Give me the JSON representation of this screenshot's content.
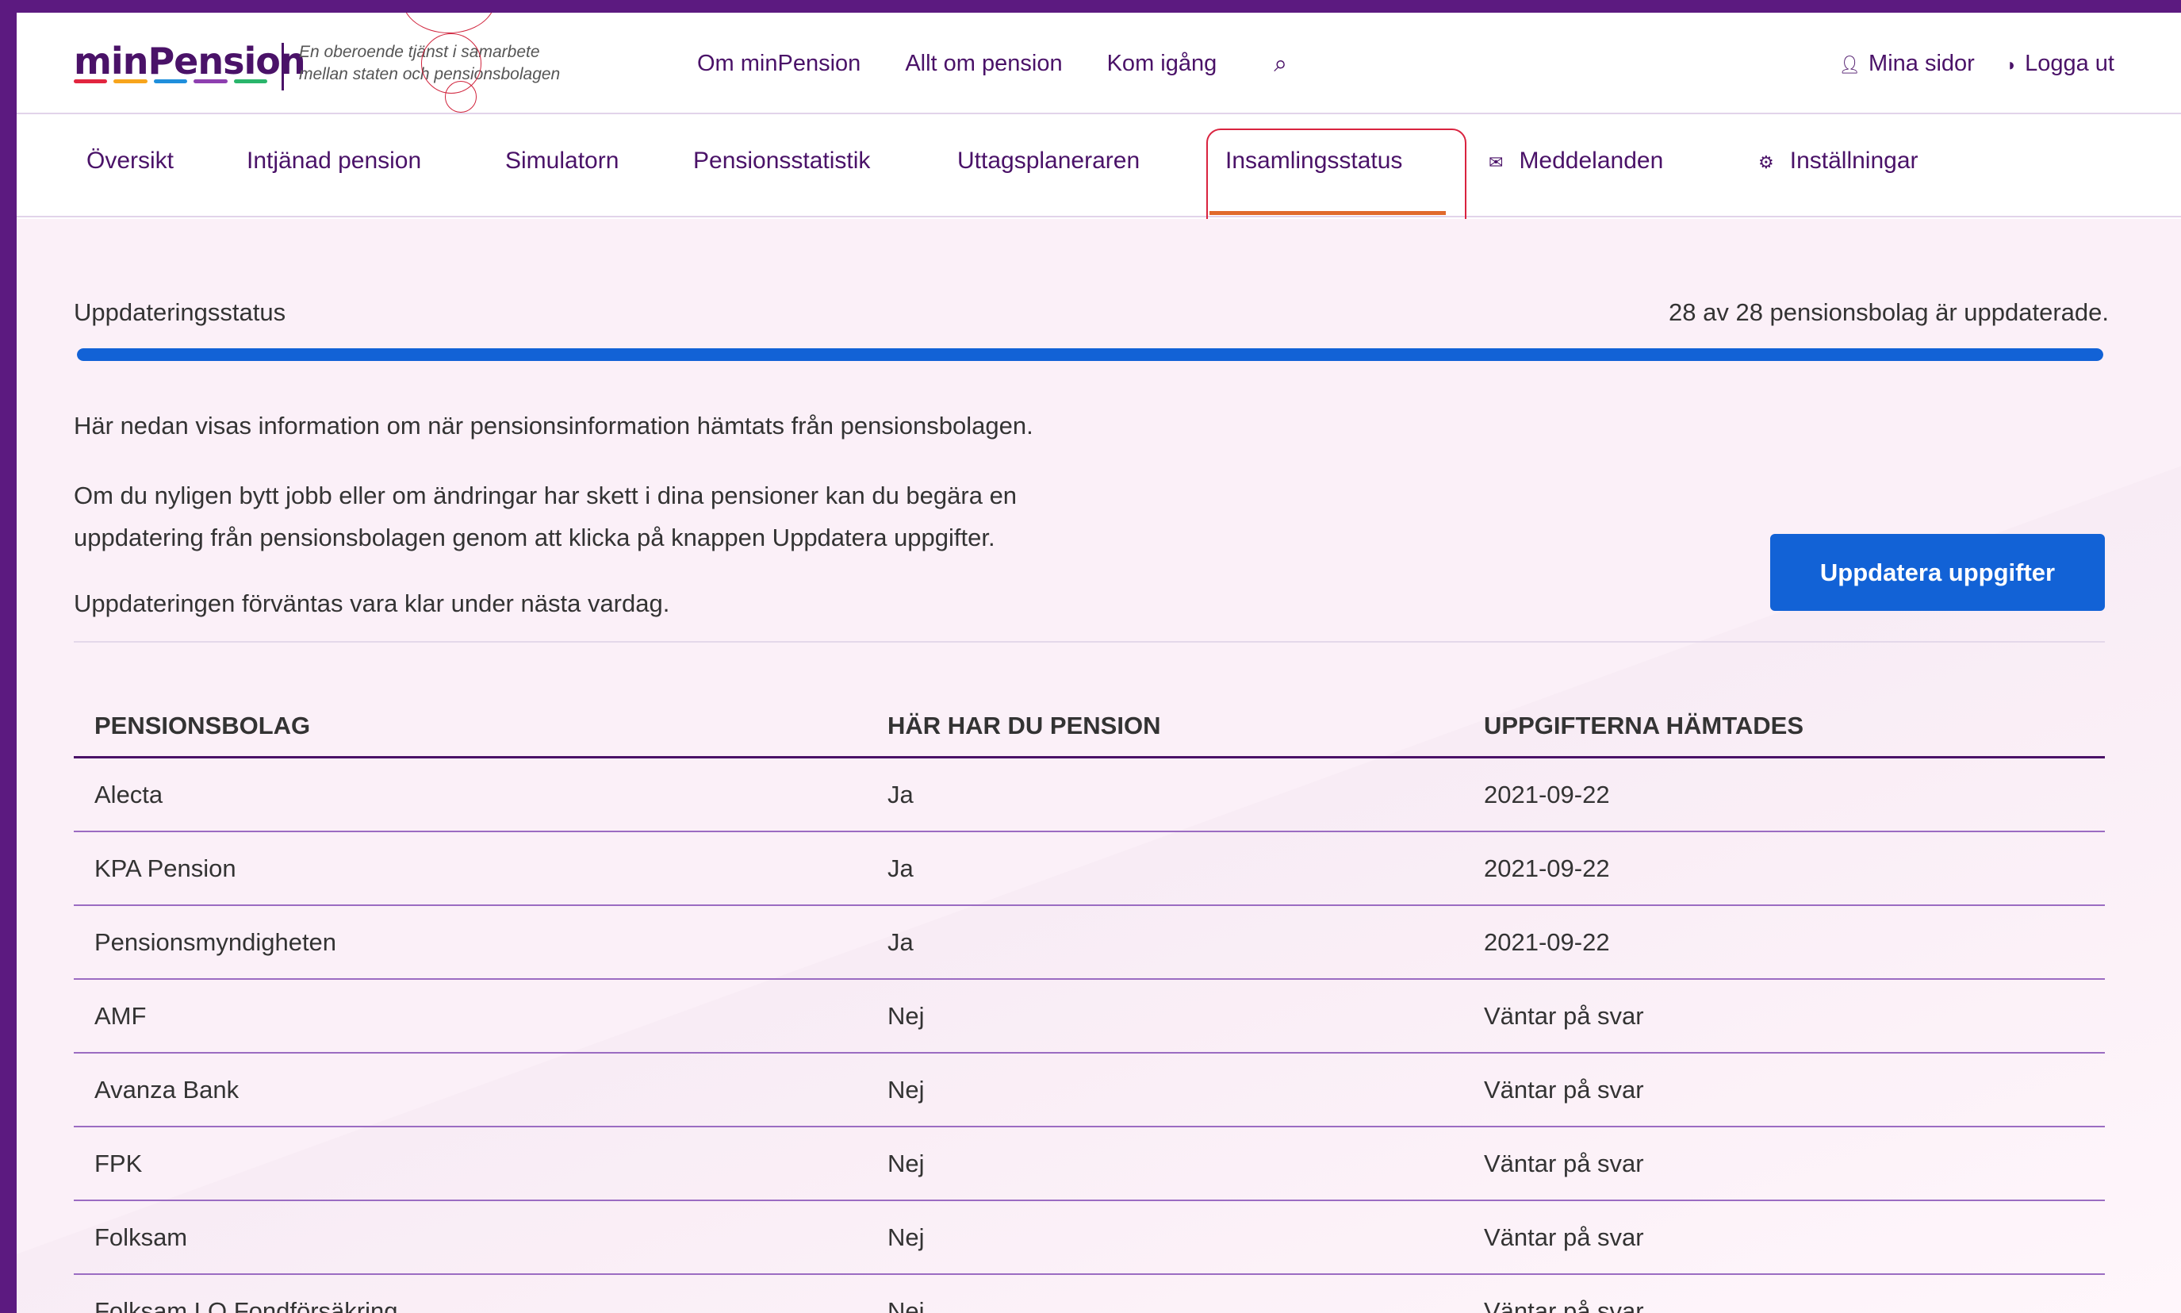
{
  "brand": {
    "logo_text": "minPension",
    "tagline_line1": "En oberoende tjänst i samarbete",
    "tagline_line2": "mellan staten och pensionsbolagen",
    "stripe_colors": [
      "#e2253f",
      "#f7a51c",
      "#1f8fdc",
      "#8e3fb0",
      "#2ab56b"
    ]
  },
  "topnav": {
    "items": [
      "Om minPension",
      "Allt om pension",
      "Kom igång"
    ],
    "search_icon": "search-icon"
  },
  "user": {
    "my_pages": "Mina sidor",
    "logout": "Logga ut"
  },
  "subnav": {
    "items": [
      {
        "label": "Översikt"
      },
      {
        "label": "Intjänad pension"
      },
      {
        "label": "Simulatorn"
      },
      {
        "label": "Pensionsstatistik"
      },
      {
        "label": "Uttagsplaneraren"
      },
      {
        "label": "Insamlingsstatus",
        "active": true
      },
      {
        "label": "Meddelanden",
        "icon": "envelope-icon"
      },
      {
        "label": "Inställningar",
        "icon": "gear-icon"
      }
    ]
  },
  "status": {
    "label": "Uppdateringsstatus",
    "count_text": "28 av 28 pensionsbolag är uppdaterade.",
    "progress_fraction": 1.0
  },
  "info": {
    "p1": "Här nedan visas information om när pensionsinformation hämtats från pensionsbolagen.",
    "p2_line1": "Om du nyligen bytt jobb eller om ändringar har skett i dina pensioner kan du begära en",
    "p2_line2": "uppdatering från pensionsbolagen genom att klicka på knappen Uppdatera uppgifter.",
    "p3": "Uppdateringen förväntas vara klar under nästa vardag."
  },
  "update_button": "Uppdatera uppgifter",
  "table": {
    "headers": [
      "PENSIONSBOLAG",
      "HÄR HAR DU PENSION",
      "UPPGIFTERNA HÄMTADES"
    ],
    "rows": [
      [
        "Alecta",
        "Ja",
        "2021-09-22"
      ],
      [
        "KPA Pension",
        "Ja",
        "2021-09-22"
      ],
      [
        "Pensionsmyndigheten",
        "Ja",
        "2021-09-22"
      ],
      [
        "AMF",
        "Nej",
        "Väntar på svar"
      ],
      [
        "Avanza Bank",
        "Nej",
        "Väntar på svar"
      ],
      [
        "FPK",
        "Nej",
        "Väntar på svar"
      ],
      [
        "Folksam",
        "Nej",
        "Väntar på svar"
      ],
      [
        "Folksam LO Fondförsäkring",
        "Nej",
        "Väntar på svar"
      ]
    ]
  }
}
